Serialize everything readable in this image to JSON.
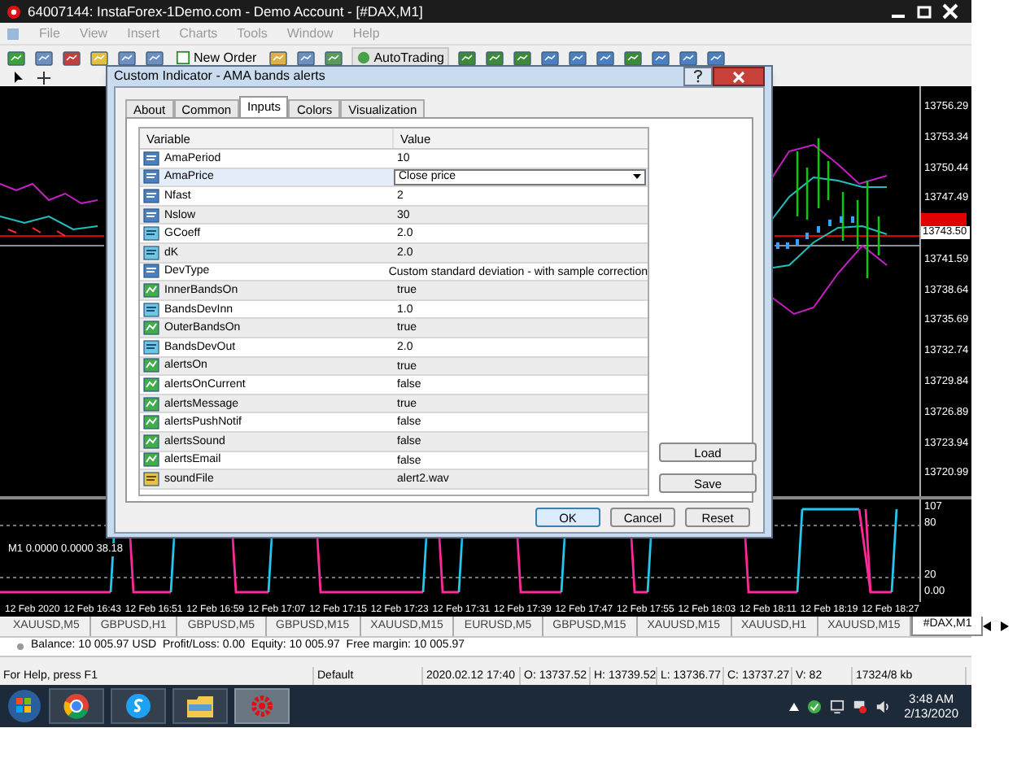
{
  "window": {
    "title": "64007144: InstaForex-1Demo.com - Demo Account - [#DAX,M1]"
  },
  "menu": [
    "File",
    "View",
    "Insert",
    "Charts",
    "Tools",
    "Window",
    "Help"
  ],
  "toolbar": {
    "new_order": "New Order",
    "auto_trading": "AutoTrading"
  },
  "price_axis": {
    "labels": [
      "13756.29",
      "13753.34",
      "13750.44",
      "13747.49",
      "13741.59",
      "13738.64",
      "13735.69",
      "13732.74",
      "13729.84",
      "13726.89",
      "13723.94",
      "13720.99"
    ],
    "bid": "13743.50"
  },
  "subwindow": {
    "label": "M1 0.0000 0.0000 38.18",
    "levels": [
      "107",
      "80",
      "20",
      "0.00"
    ]
  },
  "time_axis": [
    "12 Feb 2020",
    "12 Feb 16:43",
    "12 Feb 16:51",
    "12 Feb 16:59",
    "12 Feb 17:07",
    "12 Feb 17:15",
    "12 Feb 17:23",
    "12 Feb 17:31",
    "12 Feb 17:39",
    "12 Feb 17:47",
    "12 Feb 17:55",
    "12 Feb 18:03",
    "12 Feb 18:11",
    "12 Feb 18:19",
    "12 Feb 18:27"
  ],
  "symbol_tabs": [
    {
      "label": "XAUUSD,M5",
      "selected": false
    },
    {
      "label": "GBPUSD,H1",
      "selected": false
    },
    {
      "label": "GBPUSD,M5",
      "selected": false
    },
    {
      "label": "GBPUSD,M15",
      "selected": false
    },
    {
      "label": "XAUUSD,M15",
      "selected": false
    },
    {
      "label": "EURUSD,M5",
      "selected": false
    },
    {
      "label": "GBPUSD,M15",
      "selected": false
    },
    {
      "label": "XAUUSD,M15",
      "selected": false
    },
    {
      "label": "XAUUSD,H1",
      "selected": false
    },
    {
      "label": "XAUUSD,M15",
      "selected": false
    },
    {
      "label": "#DAX,M1",
      "selected": true
    }
  ],
  "account_line": "Balance: 10 005.97 USD  Profit/Loss: 0.00  Equity: 10 005.97  Free margin: 10 005.97",
  "status_bar": [
    "For Help, press F1",
    "Default",
    "2020.02.12 17:40",
    "O: 13737.52",
    "H: 13739.52",
    "L: 13736.77",
    "C: 13737.27",
    "V: 82",
    "17324/8 kb"
  ],
  "dialog": {
    "title": "Custom Indicator - AMA bands alerts",
    "tabs": [
      {
        "label": "About",
        "selected": false
      },
      {
        "label": "Common",
        "selected": false
      },
      {
        "label": "Inputs",
        "selected": true
      },
      {
        "label": "Colors",
        "selected": false
      },
      {
        "label": "Visualization",
        "selected": false
      }
    ],
    "columns": [
      "Variable",
      "Value"
    ],
    "rows": [
      {
        "kind": "int",
        "name": "AmaPeriod",
        "value": "10",
        "selected": false
      },
      {
        "kind": "int",
        "name": "AmaPrice",
        "value": "Close price",
        "selected": true
      },
      {
        "kind": "int",
        "name": "Nfast",
        "value": "2",
        "selected": false
      },
      {
        "kind": "int",
        "name": "Nslow",
        "value": "30",
        "selected": false
      },
      {
        "kind": "double",
        "name": "GCoeff",
        "value": "2.0",
        "selected": false
      },
      {
        "kind": "double",
        "name": "dK",
        "value": "2.0",
        "selected": false
      },
      {
        "kind": "int",
        "name": "DevType",
        "value": "Custom standard deviation - with sample correction",
        "selected": false
      },
      {
        "kind": "bool",
        "name": "InnerBandsOn",
        "value": "true",
        "selected": false
      },
      {
        "kind": "double",
        "name": "BandsDevInn",
        "value": "1.0",
        "selected": false
      },
      {
        "kind": "bool",
        "name": "OuterBandsOn",
        "value": "true",
        "selected": false
      },
      {
        "kind": "double",
        "name": "BandsDevOut",
        "value": "2.0",
        "selected": false
      },
      {
        "kind": "bool",
        "name": "alertsOn",
        "value": "true",
        "selected": false
      },
      {
        "kind": "bool",
        "name": "alertsOnCurrent",
        "value": "false",
        "selected": false
      },
      {
        "kind": "bool",
        "name": "alertsMessage",
        "value": "true",
        "selected": false
      },
      {
        "kind": "bool",
        "name": "alertsPushNotif",
        "value": "false",
        "selected": false
      },
      {
        "kind": "bool",
        "name": "alertsSound",
        "value": "false",
        "selected": false
      },
      {
        "kind": "bool",
        "name": "alertsEmail",
        "value": "false",
        "selected": false
      },
      {
        "kind": "string",
        "name": "soundFile",
        "value": "alert2.wav",
        "selected": false
      }
    ],
    "side_buttons": [
      "Load",
      "Save"
    ],
    "buttons": [
      "OK",
      "Cancel",
      "Reset"
    ]
  },
  "taskbar": {
    "time": "3:48 AM",
    "date": "2/13/2020"
  }
}
